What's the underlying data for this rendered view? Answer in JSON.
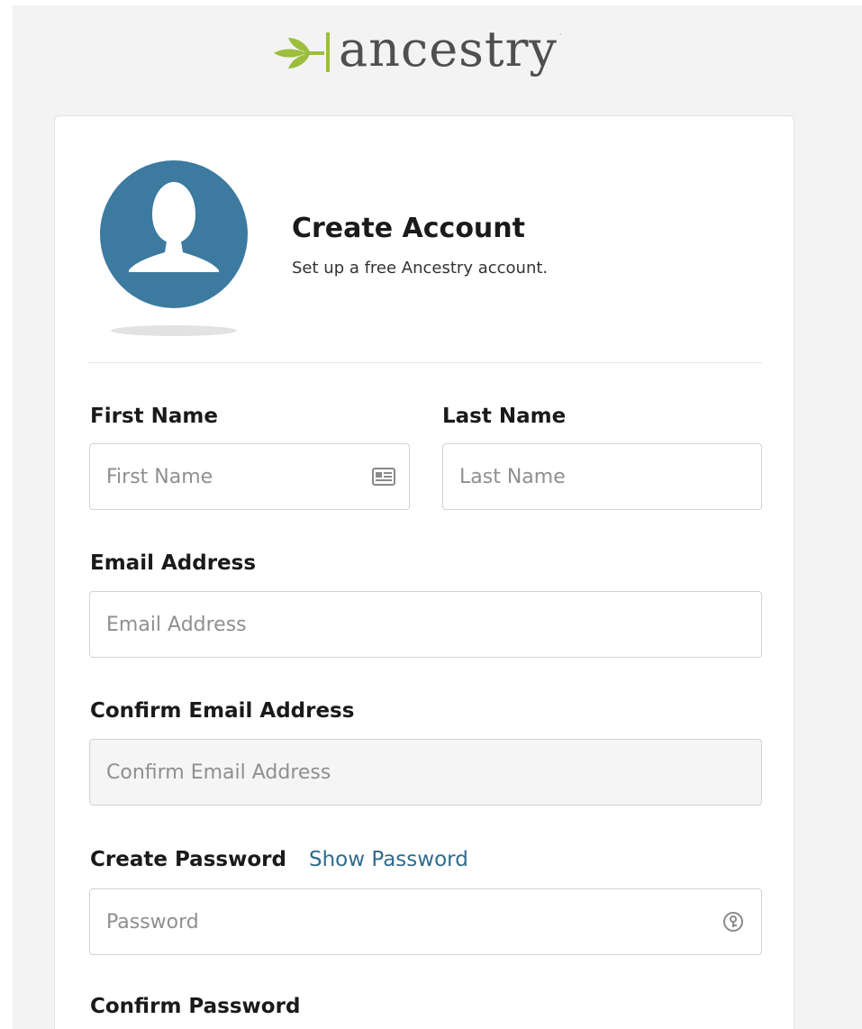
{
  "brand": {
    "name": "ancestry",
    "trademark": "·",
    "leaf_color": "#9cbe3c",
    "text_color": "#4f4f4f"
  },
  "header": {
    "title": "Create Account",
    "subtitle": "Set up a free Ancestry account.",
    "avatar_icon": "user-silhouette-icon",
    "avatar_color": "#3c7aa0"
  },
  "form": {
    "first_name": {
      "label": "First Name",
      "value": "",
      "placeholder": "First Name",
      "icon": "contact-card-icon"
    },
    "last_name": {
      "label": "Last Name",
      "value": "",
      "placeholder": "Last Name"
    },
    "email": {
      "label": "Email Address",
      "value": "",
      "placeholder": "Email Address"
    },
    "confirm_email": {
      "label": "Confirm Email Address",
      "value": "",
      "placeholder": "Confirm Email Address"
    },
    "password": {
      "label": "Create Password",
      "show_password_link": "Show Password",
      "value": "",
      "placeholder": "Password",
      "icon": "password-manager-icon"
    },
    "confirm_password": {
      "label": "Confirm Password"
    }
  }
}
